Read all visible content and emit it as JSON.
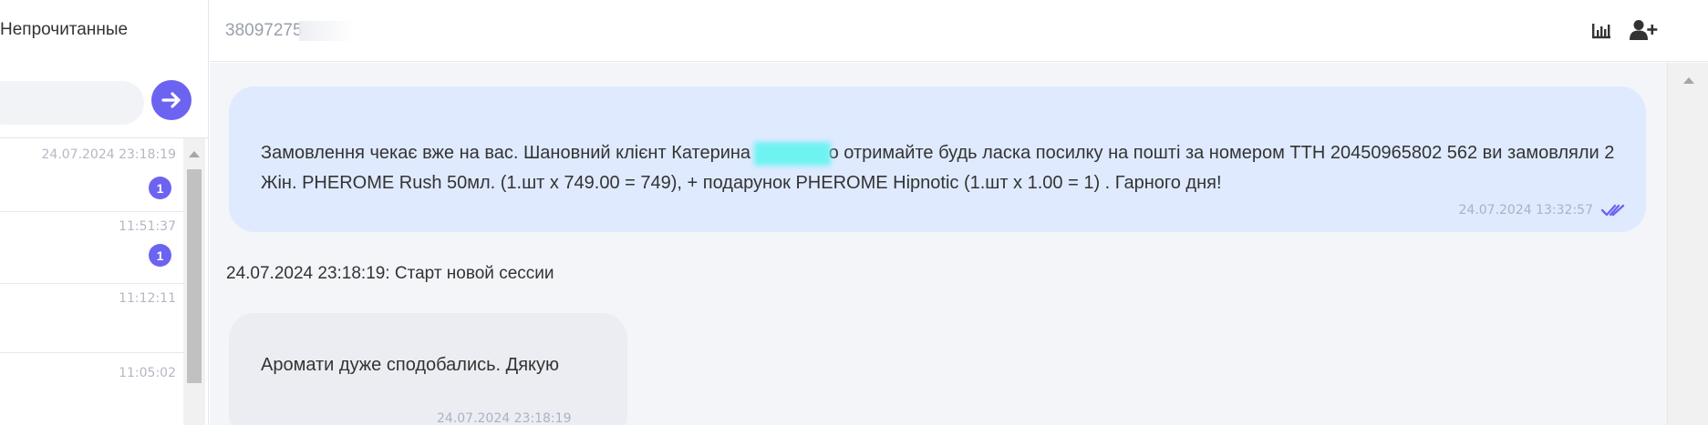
{
  "sidebar": {
    "filter_label": "Непрочитанные",
    "chats": [
      {
        "time": "24.07.2024 23:18:19",
        "unread": "1"
      },
      {
        "time": "11:51:37",
        "unread": "1"
      },
      {
        "time": "11:12:11",
        "unread": null
      },
      {
        "time": "11:05:02",
        "unread": null
      }
    ]
  },
  "header": {
    "phone": "38097275"
  },
  "conversation": {
    "outgoing": {
      "text_before": "Замовлення чекає вже на вас.  Шановний клієнт Катерина ",
      "text_after": "о отримайте будь ласка посилку на пошті за номером ТТН 20450965802 562 ви замовляли 2 Жін. PHEROME Rush 50мл. (1.шт x 749.00 = 749), + подарунок PHEROME Hipnotic (1.шт x 1.00 = 1) . Гарного дня!",
      "time": "24.07.2024 13:32:57"
    },
    "session_notice": "24.07.2024 23:18:19: Старт новой сессии",
    "incoming": {
      "text": "Аромати дуже сподобались. Дякую",
      "time": "24.07.2024 23:18:19"
    }
  },
  "colors": {
    "accent": "#6c63f0",
    "outgoing_bubble": "#dfeaff",
    "incoming_bubble": "#ebedf2",
    "name_redaction": "#6ef3f2"
  },
  "icons": [
    "arrow-right-icon",
    "bar-chart-icon",
    "add-user-icon",
    "double-check-icon",
    "scroll-up-icon"
  ]
}
